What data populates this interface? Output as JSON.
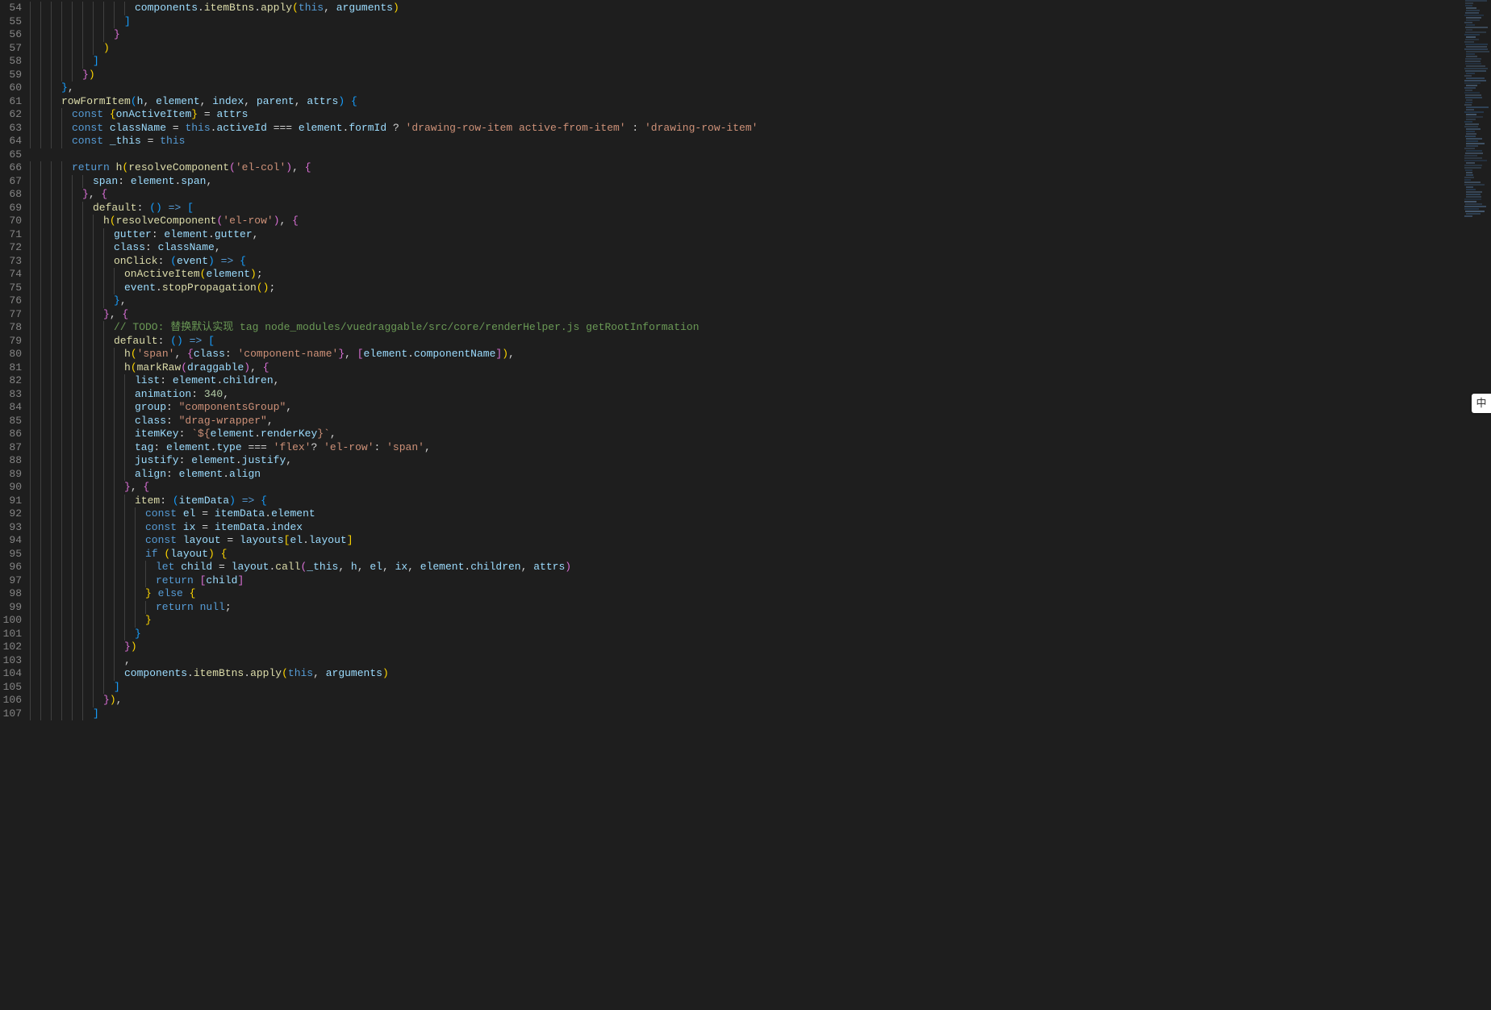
{
  "ime_badge": "中",
  "line_numbers_start": 54,
  "line_numbers_end": 107,
  "code_lines": [
    {
      "indent": 10,
      "tokens": [
        [
          "var",
          "components"
        ],
        [
          "pun",
          "."
        ],
        [
          "fn",
          "itemBtns"
        ],
        [
          "pun",
          "."
        ],
        [
          "fn",
          "apply"
        ],
        [
          "br1",
          "("
        ],
        [
          "kw",
          "this"
        ],
        [
          "pun",
          ", "
        ],
        [
          "var",
          "arguments"
        ],
        [
          "br1",
          ")"
        ]
      ]
    },
    {
      "indent": 9,
      "tokens": [
        [
          "br3",
          "]"
        ]
      ]
    },
    {
      "indent": 8,
      "tokens": [
        [
          "br2",
          "}"
        ]
      ]
    },
    {
      "indent": 7,
      "tokens": [
        [
          "br1",
          ")"
        ]
      ]
    },
    {
      "indent": 6,
      "tokens": [
        [
          "br3",
          "]"
        ]
      ]
    },
    {
      "indent": 5,
      "tokens": [
        [
          "br2",
          "}"
        ],
        [
          "br1",
          ")"
        ]
      ]
    },
    {
      "indent": 3,
      "tokens": [
        [
          "br3",
          "}"
        ],
        [
          "pun",
          ","
        ]
      ]
    },
    {
      "indent": 3,
      "tokens": [
        [
          "fn",
          "rowFormItem"
        ],
        [
          "br3",
          "("
        ],
        [
          "var",
          "h"
        ],
        [
          "pun",
          ", "
        ],
        [
          "var",
          "element"
        ],
        [
          "pun",
          ", "
        ],
        [
          "var",
          "index"
        ],
        [
          "pun",
          ", "
        ],
        [
          "var",
          "parent"
        ],
        [
          "pun",
          ", "
        ],
        [
          "var",
          "attrs"
        ],
        [
          "br3",
          ")"
        ],
        [
          "pun",
          " "
        ],
        [
          "br3",
          "{"
        ]
      ]
    },
    {
      "indent": 4,
      "tokens": [
        [
          "kw",
          "const "
        ],
        [
          "br1",
          "{"
        ],
        [
          "var",
          "onActiveItem"
        ],
        [
          "br1",
          "}"
        ],
        [
          "pun",
          " = "
        ],
        [
          "var",
          "attrs"
        ]
      ]
    },
    {
      "indent": 4,
      "tokens": [
        [
          "kw",
          "const "
        ],
        [
          "var",
          "className"
        ],
        [
          "pun",
          " = "
        ],
        [
          "kw",
          "this"
        ],
        [
          "pun",
          "."
        ],
        [
          "prop",
          "activeId"
        ],
        [
          "pun",
          " === "
        ],
        [
          "var",
          "element"
        ],
        [
          "pun",
          "."
        ],
        [
          "prop",
          "formId"
        ],
        [
          "pun",
          " ? "
        ],
        [
          "str",
          "'drawing-row-item active-from-item'"
        ],
        [
          "pun",
          " : "
        ],
        [
          "str",
          "'drawing-row-item'"
        ]
      ]
    },
    {
      "indent": 4,
      "tokens": [
        [
          "kw",
          "const "
        ],
        [
          "var",
          "_this"
        ],
        [
          "pun",
          " = "
        ],
        [
          "kw",
          "this"
        ]
      ]
    },
    {
      "indent": 0,
      "tokens": []
    },
    {
      "indent": 4,
      "tokens": [
        [
          "kw",
          "return "
        ],
        [
          "fn",
          "h"
        ],
        [
          "br1",
          "("
        ],
        [
          "fn",
          "resolveComponent"
        ],
        [
          "br2",
          "("
        ],
        [
          "str",
          "'el-col'"
        ],
        [
          "br2",
          ")"
        ],
        [
          "pun",
          ", "
        ],
        [
          "br2",
          "{"
        ]
      ]
    },
    {
      "indent": 6,
      "tokens": [
        [
          "prop",
          "span"
        ],
        [
          "pun",
          ": "
        ],
        [
          "var",
          "element"
        ],
        [
          "pun",
          "."
        ],
        [
          "prop",
          "span"
        ],
        [
          "pun",
          ","
        ]
      ]
    },
    {
      "indent": 5,
      "tokens": [
        [
          "br2",
          "}"
        ],
        [
          "pun",
          ", "
        ],
        [
          "br2",
          "{"
        ]
      ]
    },
    {
      "indent": 6,
      "tokens": [
        [
          "fn",
          "default"
        ],
        [
          "pun",
          ": "
        ],
        [
          "br3",
          "("
        ],
        [
          "br3",
          ")"
        ],
        [
          "pun",
          " "
        ],
        [
          "kw",
          "=>"
        ],
        [
          "pun",
          " "
        ],
        [
          "br3",
          "["
        ]
      ]
    },
    {
      "indent": 7,
      "tokens": [
        [
          "fn",
          "h"
        ],
        [
          "br1",
          "("
        ],
        [
          "fn",
          "resolveComponent"
        ],
        [
          "br2",
          "("
        ],
        [
          "str",
          "'el-row'"
        ],
        [
          "br2",
          ")"
        ],
        [
          "pun",
          ", "
        ],
        [
          "br2",
          "{"
        ]
      ]
    },
    {
      "indent": 8,
      "tokens": [
        [
          "prop",
          "gutter"
        ],
        [
          "pun",
          ": "
        ],
        [
          "var",
          "element"
        ],
        [
          "pun",
          "."
        ],
        [
          "prop",
          "gutter"
        ],
        [
          "pun",
          ","
        ]
      ]
    },
    {
      "indent": 8,
      "tokens": [
        [
          "prop",
          "class"
        ],
        [
          "pun",
          ": "
        ],
        [
          "var",
          "className"
        ],
        [
          "pun",
          ","
        ]
      ]
    },
    {
      "indent": 8,
      "tokens": [
        [
          "fn",
          "onClick"
        ],
        [
          "pun",
          ": "
        ],
        [
          "br3",
          "("
        ],
        [
          "var",
          "event"
        ],
        [
          "br3",
          ")"
        ],
        [
          "pun",
          " "
        ],
        [
          "kw",
          "=>"
        ],
        [
          "pun",
          " "
        ],
        [
          "br3",
          "{"
        ]
      ]
    },
    {
      "indent": 9,
      "tokens": [
        [
          "fn",
          "onActiveItem"
        ],
        [
          "br1",
          "("
        ],
        [
          "var",
          "element"
        ],
        [
          "br1",
          ")"
        ],
        [
          "pun",
          ";"
        ]
      ]
    },
    {
      "indent": 9,
      "tokens": [
        [
          "var",
          "event"
        ],
        [
          "pun",
          "."
        ],
        [
          "fn",
          "stopPropagation"
        ],
        [
          "br1",
          "("
        ],
        [
          "br1",
          ")"
        ],
        [
          "pun",
          ";"
        ]
      ]
    },
    {
      "indent": 8,
      "tokens": [
        [
          "br3",
          "}"
        ],
        [
          "pun",
          ","
        ]
      ]
    },
    {
      "indent": 7,
      "tokens": [
        [
          "br2",
          "}"
        ],
        [
          "pun",
          ", "
        ],
        [
          "br2",
          "{"
        ]
      ]
    },
    {
      "indent": 8,
      "tokens": [
        [
          "cmt",
          "// TODO: 替换默认实现 tag node_modules/vuedraggable/src/core/renderHelper.js getRootInformation"
        ]
      ]
    },
    {
      "indent": 8,
      "tokens": [
        [
          "fn",
          "default"
        ],
        [
          "pun",
          ": "
        ],
        [
          "br3",
          "("
        ],
        [
          "br3",
          ")"
        ],
        [
          "pun",
          " "
        ],
        [
          "kw",
          "=>"
        ],
        [
          "pun",
          " "
        ],
        [
          "br3",
          "["
        ]
      ]
    },
    {
      "indent": 9,
      "tokens": [
        [
          "fn",
          "h"
        ],
        [
          "br1",
          "("
        ],
        [
          "str",
          "'span'"
        ],
        [
          "pun",
          ", "
        ],
        [
          "br2",
          "{"
        ],
        [
          "prop",
          "class"
        ],
        [
          "pun",
          ": "
        ],
        [
          "str",
          "'component-name'"
        ],
        [
          "br2",
          "}"
        ],
        [
          "pun",
          ", "
        ],
        [
          "br2",
          "["
        ],
        [
          "var",
          "element"
        ],
        [
          "pun",
          "."
        ],
        [
          "prop",
          "componentName"
        ],
        [
          "br2",
          "]"
        ],
        [
          "br1",
          ")"
        ],
        [
          "pun",
          ","
        ]
      ]
    },
    {
      "indent": 9,
      "tokens": [
        [
          "fn",
          "h"
        ],
        [
          "br1",
          "("
        ],
        [
          "fn",
          "markRaw"
        ],
        [
          "br2",
          "("
        ],
        [
          "var",
          "draggable"
        ],
        [
          "br2",
          ")"
        ],
        [
          "pun",
          ", "
        ],
        [
          "br2",
          "{"
        ]
      ]
    },
    {
      "indent": 10,
      "tokens": [
        [
          "prop",
          "list"
        ],
        [
          "pun",
          ": "
        ],
        [
          "var",
          "element"
        ],
        [
          "pun",
          "."
        ],
        [
          "prop",
          "children"
        ],
        [
          "pun",
          ","
        ]
      ]
    },
    {
      "indent": 10,
      "tokens": [
        [
          "prop",
          "animation"
        ],
        [
          "pun",
          ": "
        ],
        [
          "num",
          "340"
        ],
        [
          "pun",
          ","
        ]
      ]
    },
    {
      "indent": 10,
      "tokens": [
        [
          "prop",
          "group"
        ],
        [
          "pun",
          ": "
        ],
        [
          "str",
          "\"componentsGroup\""
        ],
        [
          "pun",
          ","
        ]
      ]
    },
    {
      "indent": 10,
      "tokens": [
        [
          "prop",
          "class"
        ],
        [
          "pun",
          ": "
        ],
        [
          "str",
          "\"drag-wrapper\""
        ],
        [
          "pun",
          ","
        ]
      ]
    },
    {
      "indent": 10,
      "tokens": [
        [
          "prop",
          "itemKey"
        ],
        [
          "pun",
          ": "
        ],
        [
          "str",
          "`${"
        ],
        [
          "var",
          "element"
        ],
        [
          "pun",
          "."
        ],
        [
          "prop",
          "renderKey"
        ],
        [
          "str",
          "}`"
        ],
        [
          "pun",
          ","
        ]
      ]
    },
    {
      "indent": 10,
      "tokens": [
        [
          "prop",
          "tag"
        ],
        [
          "pun",
          ": "
        ],
        [
          "var",
          "element"
        ],
        [
          "pun",
          "."
        ],
        [
          "prop",
          "type"
        ],
        [
          "pun",
          " === "
        ],
        [
          "str",
          "'flex'"
        ],
        [
          "pun",
          "? "
        ],
        [
          "str",
          "'el-row'"
        ],
        [
          "pun",
          ": "
        ],
        [
          "str",
          "'span'"
        ],
        [
          "pun",
          ","
        ]
      ]
    },
    {
      "indent": 10,
      "tokens": [
        [
          "prop",
          "justify"
        ],
        [
          "pun",
          ": "
        ],
        [
          "var",
          "element"
        ],
        [
          "pun",
          "."
        ],
        [
          "prop",
          "justify"
        ],
        [
          "pun",
          ","
        ]
      ]
    },
    {
      "indent": 10,
      "tokens": [
        [
          "prop",
          "align"
        ],
        [
          "pun",
          ": "
        ],
        [
          "var",
          "element"
        ],
        [
          "pun",
          "."
        ],
        [
          "prop",
          "align"
        ]
      ]
    },
    {
      "indent": 9,
      "tokens": [
        [
          "br2",
          "}"
        ],
        [
          "pun",
          ", "
        ],
        [
          "br2",
          "{"
        ]
      ]
    },
    {
      "indent": 10,
      "tokens": [
        [
          "fn",
          "item"
        ],
        [
          "pun",
          ": "
        ],
        [
          "br3",
          "("
        ],
        [
          "var",
          "itemData"
        ],
        [
          "br3",
          ")"
        ],
        [
          "pun",
          " "
        ],
        [
          "kw",
          "=>"
        ],
        [
          "pun",
          " "
        ],
        [
          "br3",
          "{"
        ]
      ]
    },
    {
      "indent": 11,
      "tokens": [
        [
          "kw",
          "const "
        ],
        [
          "var",
          "el"
        ],
        [
          "pun",
          " = "
        ],
        [
          "var",
          "itemData"
        ],
        [
          "pun",
          "."
        ],
        [
          "prop",
          "element"
        ]
      ]
    },
    {
      "indent": 11,
      "tokens": [
        [
          "kw",
          "const "
        ],
        [
          "var",
          "ix"
        ],
        [
          "pun",
          " = "
        ],
        [
          "var",
          "itemData"
        ],
        [
          "pun",
          "."
        ],
        [
          "prop",
          "index"
        ]
      ]
    },
    {
      "indent": 11,
      "tokens": [
        [
          "kw",
          "const "
        ],
        [
          "var",
          "layout"
        ],
        [
          "pun",
          " = "
        ],
        [
          "var",
          "layouts"
        ],
        [
          "br1",
          "["
        ],
        [
          "var",
          "el"
        ],
        [
          "pun",
          "."
        ],
        [
          "prop",
          "layout"
        ],
        [
          "br1",
          "]"
        ]
      ]
    },
    {
      "indent": 11,
      "tokens": [
        [
          "kw",
          "if "
        ],
        [
          "br1",
          "("
        ],
        [
          "var",
          "layout"
        ],
        [
          "br1",
          ")"
        ],
        [
          "pun",
          " "
        ],
        [
          "br1",
          "{"
        ]
      ]
    },
    {
      "indent": 12,
      "tokens": [
        [
          "kw",
          "let "
        ],
        [
          "var",
          "child"
        ],
        [
          "pun",
          " = "
        ],
        [
          "var",
          "layout"
        ],
        [
          "pun",
          "."
        ],
        [
          "fn",
          "call"
        ],
        [
          "br2",
          "("
        ],
        [
          "var",
          "_this"
        ],
        [
          "pun",
          ", "
        ],
        [
          "var",
          "h"
        ],
        [
          "pun",
          ", "
        ],
        [
          "var",
          "el"
        ],
        [
          "pun",
          ", "
        ],
        [
          "var",
          "ix"
        ],
        [
          "pun",
          ", "
        ],
        [
          "var",
          "element"
        ],
        [
          "pun",
          "."
        ],
        [
          "prop",
          "children"
        ],
        [
          "pun",
          ", "
        ],
        [
          "var",
          "attrs"
        ],
        [
          "br2",
          ")"
        ]
      ]
    },
    {
      "indent": 12,
      "tokens": [
        [
          "kw",
          "return "
        ],
        [
          "br2",
          "["
        ],
        [
          "var",
          "child"
        ],
        [
          "br2",
          "]"
        ]
      ]
    },
    {
      "indent": 11,
      "tokens": [
        [
          "br1",
          "}"
        ],
        [
          "pun",
          " "
        ],
        [
          "kw",
          "else "
        ],
        [
          "br1",
          "{"
        ]
      ]
    },
    {
      "indent": 12,
      "tokens": [
        [
          "kw",
          "return "
        ],
        [
          "const",
          "null"
        ],
        [
          "pun",
          ";"
        ]
      ]
    },
    {
      "indent": 11,
      "tokens": [
        [
          "br1",
          "}"
        ]
      ]
    },
    {
      "indent": 10,
      "tokens": [
        [
          "br3",
          "}"
        ]
      ]
    },
    {
      "indent": 9,
      "tokens": [
        [
          "br2",
          "}"
        ],
        [
          "br1",
          ")"
        ]
      ]
    },
    {
      "indent": 9,
      "tokens": [
        [
          "pun",
          ","
        ]
      ]
    },
    {
      "indent": 9,
      "tokens": [
        [
          "var",
          "components"
        ],
        [
          "pun",
          "."
        ],
        [
          "fn",
          "itemBtns"
        ],
        [
          "pun",
          "."
        ],
        [
          "fn",
          "apply"
        ],
        [
          "br1",
          "("
        ],
        [
          "kw",
          "this"
        ],
        [
          "pun",
          ", "
        ],
        [
          "var",
          "arguments"
        ],
        [
          "br1",
          ")"
        ]
      ]
    },
    {
      "indent": 8,
      "tokens": [
        [
          "br3",
          "]"
        ]
      ]
    },
    {
      "indent": 7,
      "tokens": [
        [
          "br2",
          "}"
        ],
        [
          "br1",
          ")"
        ],
        [
          "pun",
          ","
        ]
      ]
    },
    {
      "indent": 6,
      "tokens": [
        [
          "br3",
          "]"
        ]
      ]
    }
  ]
}
